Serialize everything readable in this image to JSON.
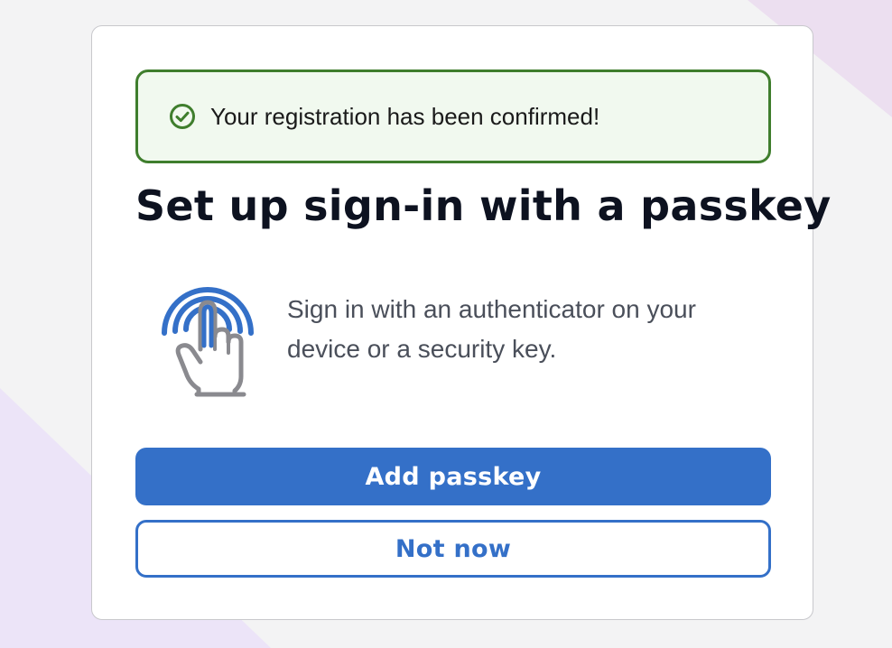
{
  "theme": {
    "primary_color": "#3470c8",
    "success_color": "#3f7e2d",
    "success_bg": "#f1f9ef",
    "title_color": "#0d1220",
    "text_color": "#4a4f5a"
  },
  "alert": {
    "icon": "check-circle-icon",
    "message": "Your registration has been confirmed!"
  },
  "page": {
    "title": "Set up sign-in with a passkey",
    "illustration": "fingerprint-touch-icon",
    "description": "Sign in with an authenticator on your device or a security key."
  },
  "actions": {
    "add_passkey_label": "Add passkey",
    "not_now_label": "Not now"
  }
}
